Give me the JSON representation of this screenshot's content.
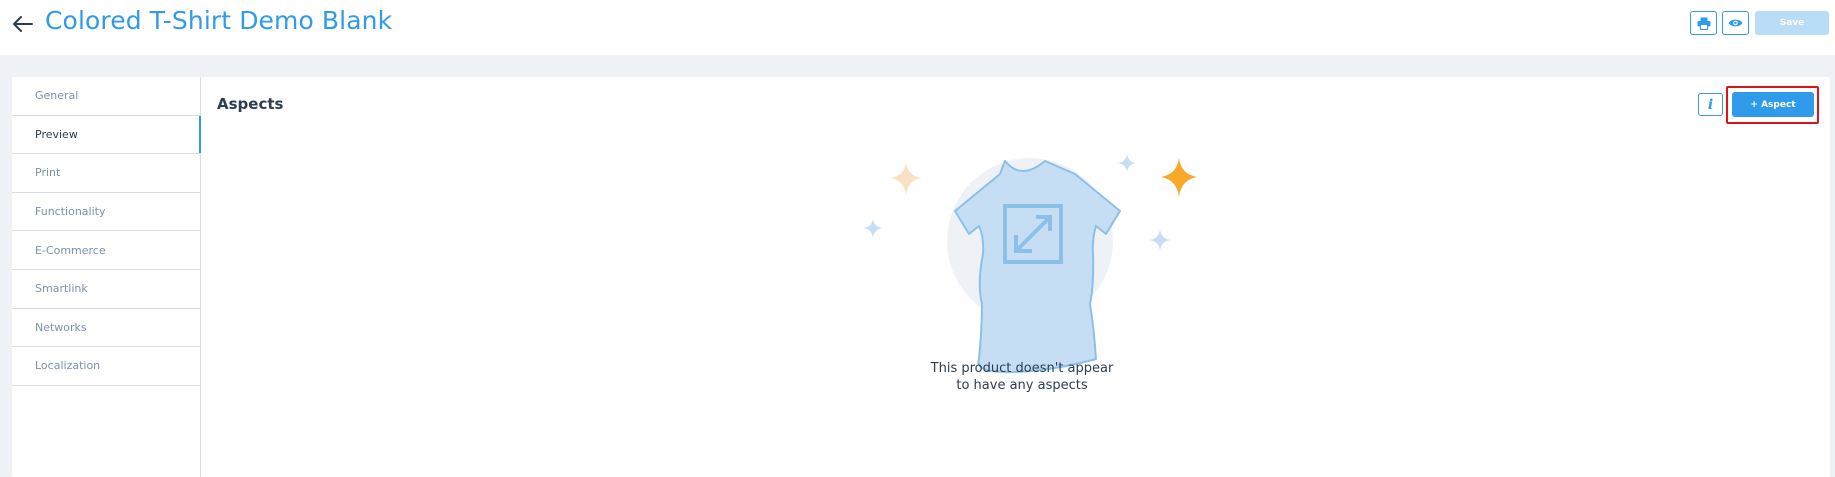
{
  "header": {
    "title": "Colored T-Shirt Demo Blank",
    "save_label": "Save",
    "icons": [
      "back-arrow-icon",
      "print-icon",
      "eye-icon"
    ]
  },
  "sidebar": {
    "items": [
      {
        "label": "General"
      },
      {
        "label": "Preview"
      },
      {
        "label": "Print"
      },
      {
        "label": "Functionality"
      },
      {
        "label": "E-Commerce"
      },
      {
        "label": "Smartlink"
      },
      {
        "label": "Networks"
      },
      {
        "label": "Localization"
      }
    ],
    "active": "Preview"
  },
  "main": {
    "section_title": "Aspects",
    "info_label": "i",
    "add_aspect_label": "+ Aspect",
    "empty_line1": "This product doesn't appear",
    "empty_line2": "to have any aspects"
  },
  "colors": {
    "accent": "#2f9bea",
    "highlight": "#e0131b",
    "save_disabled": "#b9dcf7",
    "shirt": "#c5def3",
    "star_orange": "#f7a829"
  }
}
